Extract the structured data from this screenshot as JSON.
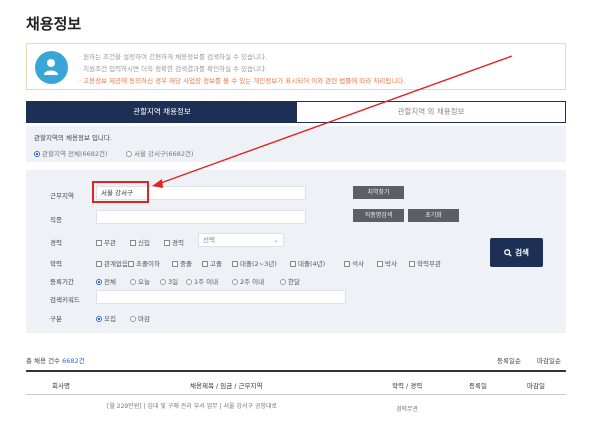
{
  "header": {
    "title": "채용정보"
  },
  "notice": {
    "icon": "person-search-icon",
    "lines": [
      "· 원하는 조건을 설정하여 간편하게 채용정보를 검색하실 수 있습니다.",
      "· 지원조건 입력하시면 더욱 정확한 검색결과를 확인하실 수 있습니다.",
      "· 고용정보 제공에 동의하신 경우 해당 사업장 정보를 볼 수 있는 개인정보가 표시되어 이와 관련 법률에 따라 처리됩니다."
    ]
  },
  "tabs": [
    {
      "label": "관할지역 채용정보",
      "active": true
    },
    {
      "label": "관할지역 외 채용정보",
      "active": false
    }
  ],
  "region": {
    "title": "관할지역의 채용정보 입니다.",
    "options": [
      {
        "label": "관할지역 전체(6682건)",
        "checked": true
      },
      {
        "label": "서울 강서구(6682건)",
        "checked": false
      }
    ]
  },
  "form": {
    "region_label": "근무지역",
    "region_value": "서울 강서구",
    "region_button": "지역찾기",
    "job_label": "직종",
    "job_button": "직종명검색",
    "job_reset_button": "초기화",
    "career_label": "경력",
    "career_options": [
      "무관",
      "신입",
      "경력"
    ],
    "career_select": "선택",
    "education_label": "학력",
    "education_options": [
      "관계없음",
      "초졸이하",
      "중졸",
      "고졸",
      "대졸(2~3년)",
      "대졸(4년)",
      "석사",
      "박사",
      "학력무관"
    ],
    "period_label": "등록기간",
    "period_options": [
      "전체",
      "오늘",
      "3일",
      "1주 이내",
      "2주 이내",
      "한달"
    ],
    "keyword_label": "검색키워드",
    "type_label": "구분",
    "type_options": [
      "모집",
      "마감"
    ],
    "search_button": "검색",
    "search_icon": "magnifier-icon"
  },
  "results": {
    "count_label": "총 채용 건수",
    "count_value": "6682건",
    "sort_options": [
      "등록일순",
      "마감일순"
    ],
    "columns": [
      "회사명",
      "채용제목 / 임금 / 근무지역",
      "학력 / 경력",
      "등록일",
      "마감일"
    ],
    "first_row": [
      "[월 229만원] | 임대 및 구매 관리 부서 업무 | 서울 강서구 공항대로",
      "경력무관"
    ]
  },
  "colors": {
    "navy": "#1e2f55",
    "highlight_red": "#e02424",
    "panel_bg": "#eef2f7",
    "icon_blue": "#3aa6d8"
  }
}
